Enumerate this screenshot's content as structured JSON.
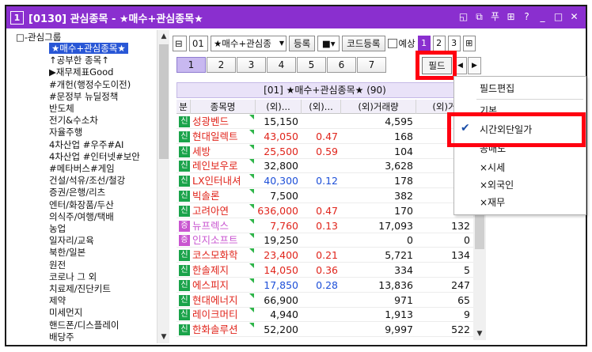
{
  "window": {
    "number": "1",
    "title": "[0130] 관심종목 - ★매수+관심종목★",
    "controls": [
      "◱",
      "⧉",
      "푸",
      "⊞",
      "?",
      "_",
      "□",
      "✕"
    ]
  },
  "tree": {
    "root": "□-관심그룹",
    "items": [
      {
        "label": "★매수+관심종목★",
        "selected": true
      },
      {
        "label": "↑공부한 종목↑"
      },
      {
        "label": "▶재무제표Good"
      },
      {
        "label": "#개헌(행정수도이전)"
      },
      {
        "label": "#문정부 뉴딜정책"
      },
      {
        "label": "반도체"
      },
      {
        "label": "전기&수소차"
      },
      {
        "label": "자율주행"
      },
      {
        "label": "4차산업 #우주#AI"
      },
      {
        "label": "4차산업 #인터넷#보안"
      },
      {
        "label": "#메타버스#게임"
      },
      {
        "label": "건설/석유/조선/철강"
      },
      {
        "label": "증권/은행/리츠"
      },
      {
        "label": "엔터/화장품/두산"
      },
      {
        "label": "의식주/여행/택배"
      },
      {
        "label": "농업"
      },
      {
        "label": "일자리/교육"
      },
      {
        "label": "북한/일본"
      },
      {
        "label": "원전"
      },
      {
        "label": "코로나 그 외"
      },
      {
        "label": "치료제/진단키트"
      },
      {
        "label": "제약"
      },
      {
        "label": "미세먼지"
      },
      {
        "label": "핸드폰/디스플레이"
      },
      {
        "label": "배당주"
      }
    ]
  },
  "toolbar": {
    "group_num": "01",
    "group_name": "★매수+관심종",
    "register_btn": "등록",
    "code_register_btn": "코드등록",
    "forecast_label": "예상",
    "pages": [
      "1",
      "2",
      "3"
    ]
  },
  "tabs": [
    "1",
    "2",
    "3",
    "4",
    "5",
    "6",
    "7"
  ],
  "field_button": "필드",
  "group_title": "[01] ★매수+관심종목★ (90)",
  "columns": [
    "분",
    "종목명",
    "(외)...",
    "(외)...",
    "(외)거래량",
    "(외)거"
  ],
  "rows": [
    {
      "badge": "신",
      "name": "성광벤드",
      "price": "15,150",
      "change": "",
      "volume": "4,595",
      "extra": "",
      "color": "red"
    },
    {
      "badge": "신",
      "name": "현대일렉트",
      "price": "43,050",
      "change": "0.47",
      "volume": "168",
      "extra": "",
      "color": "red"
    },
    {
      "badge": "신",
      "name": "세방",
      "price": "25,500",
      "change": "0.59",
      "volume": "104",
      "extra": "",
      "color": "red"
    },
    {
      "badge": "신",
      "name": "레인보우로",
      "price": "32,800",
      "change": "",
      "volume": "3,628",
      "extra": "",
      "color": "red"
    },
    {
      "badge": "신",
      "name": "LX인터내셔",
      "price": "40,300",
      "change": "0.12",
      "volume": "178",
      "extra": "",
      "color": "blue"
    },
    {
      "badge": "신",
      "name": "빅솔론",
      "price": "7,500",
      "change": "",
      "volume": "382",
      "extra": "",
      "color": "red"
    },
    {
      "badge": "신",
      "name": "고려아연",
      "price": "636,000",
      "change": "0.47",
      "volume": "170",
      "extra": "",
      "color": "red"
    },
    {
      "badge": "증",
      "name": "뉴프렉스",
      "price": "7,760",
      "change": "0.13",
      "volume": "17,093",
      "extra": "132",
      "color": "red"
    },
    {
      "badge": "증",
      "name": "인지소프트",
      "price": "19,250",
      "change": "",
      "volume": "0",
      "extra": "0",
      "color": "red"
    },
    {
      "badge": "신",
      "name": "코스모화학",
      "price": "23,400",
      "change": "0.21",
      "volume": "5,721",
      "extra": "134",
      "color": "red"
    },
    {
      "badge": "신",
      "name": "한솔제지",
      "price": "14,050",
      "change": "0.36",
      "volume": "334",
      "extra": "5",
      "color": "red"
    },
    {
      "badge": "신",
      "name": "에스피지",
      "price": "17,850",
      "change": "0.28",
      "volume": "13,836",
      "extra": "247",
      "color": "blue"
    },
    {
      "badge": "신",
      "name": "현대에너지",
      "price": "66,900",
      "change": "",
      "volume": "971",
      "extra": "65",
      "color": "red"
    },
    {
      "badge": "신",
      "name": "레이크머티",
      "price": "4,940",
      "change": "",
      "volume": "1,913",
      "extra": "9",
      "color": "red"
    },
    {
      "badge": "신",
      "name": "한화솔루션",
      "price": "52,200",
      "change": "",
      "volume": "9,997",
      "extra": "522",
      "color": "red"
    }
  ],
  "field_menu": {
    "items": [
      "필드편집",
      "기본",
      "시간외단일가",
      "공매도",
      "×시세",
      "×외국인",
      "×재무"
    ],
    "checked": "시간외단일가"
  },
  "colors": {
    "title_bar": "#8a2fcf",
    "highlight": "#ff0010",
    "selection": "#2957d6",
    "up": "#e0241b",
    "down": "#1d4fd8",
    "badge_new": "#1aa34a",
    "badge_sec": "#c955d0"
  }
}
